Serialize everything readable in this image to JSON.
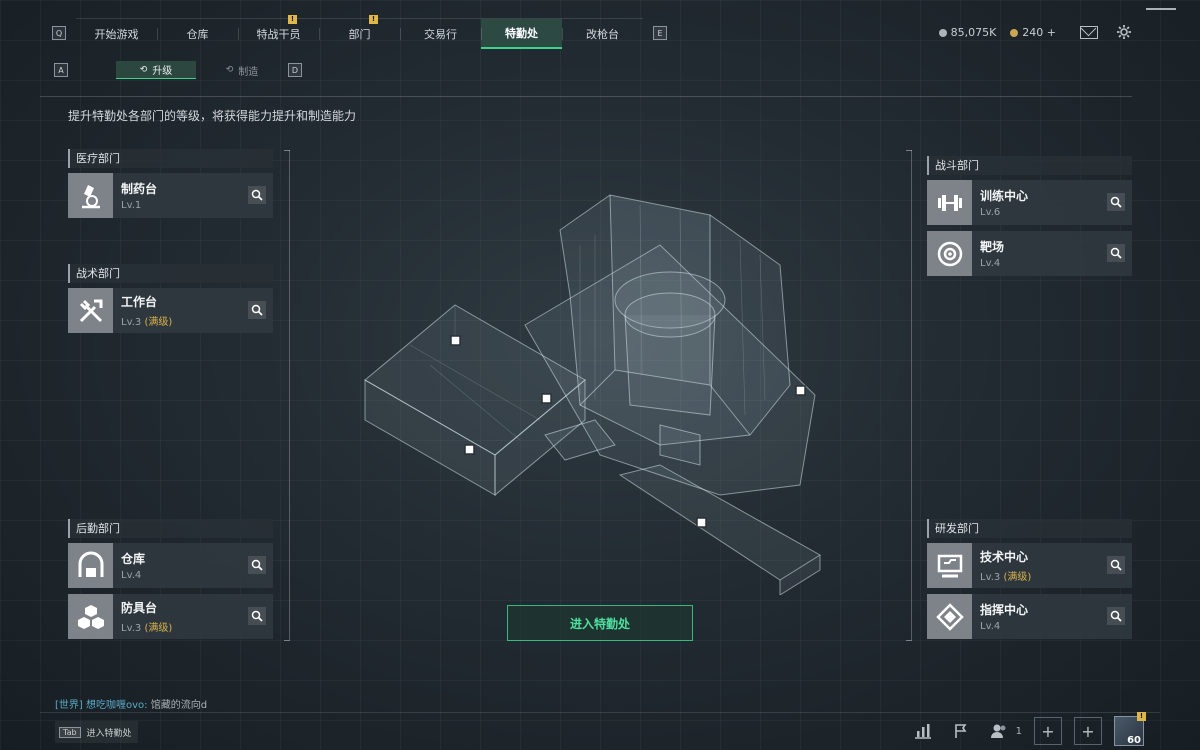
{
  "nav": {
    "key_left": "Q",
    "key_right": "E",
    "tabs": [
      {
        "label": "开始游戏",
        "alert": false,
        "active": false
      },
      {
        "label": "仓库",
        "alert": false,
        "active": false
      },
      {
        "label": "特战干员",
        "alert": true,
        "active": false
      },
      {
        "label": "部门",
        "alert": true,
        "active": false
      },
      {
        "label": "交易行",
        "alert": false,
        "active": false
      },
      {
        "label": "特勤处",
        "alert": false,
        "active": true
      },
      {
        "label": "改枪台",
        "alert": false,
        "active": false
      }
    ],
    "alert_mark": "!"
  },
  "currency": {
    "silver": "85,075K",
    "gold": "240 +"
  },
  "subnav": {
    "key_left": "A",
    "key_right": "D",
    "tabs": [
      {
        "label": "升级",
        "active": true
      },
      {
        "label": "制造",
        "active": false
      }
    ]
  },
  "description": "提升特勤处各部门的等级，将获得能力提升和制造能力",
  "departments": {
    "medical": {
      "title": "医疗部门",
      "facilities": [
        {
          "name": "制药台",
          "level": "Lv.1",
          "max": ""
        }
      ]
    },
    "tactical": {
      "title": "战术部门",
      "facilities": [
        {
          "name": "工作台",
          "level": "Lv.3",
          "max": "(满级)"
        }
      ]
    },
    "logistics": {
      "title": "后勤部门",
      "facilities": [
        {
          "name": "仓库",
          "level": "Lv.4",
          "max": ""
        },
        {
          "name": "防具台",
          "level": "Lv.3",
          "max": "(满级)"
        }
      ]
    },
    "combat": {
      "title": "战斗部门",
      "facilities": [
        {
          "name": "训练中心",
          "level": "Lv.6",
          "max": ""
        },
        {
          "name": "靶场",
          "level": "Lv.4",
          "max": ""
        }
      ]
    },
    "research": {
      "title": "研发部门",
      "facilities": [
        {
          "name": "技术中心",
          "level": "Lv.3",
          "max": "(满级)"
        },
        {
          "name": "指挥中心",
          "level": "Lv.4",
          "max": ""
        }
      ]
    }
  },
  "enter_button": "进入特勤处",
  "chat": {
    "channel": "[世界]",
    "sender": "想吃咖喱ovo:",
    "message": "馆藏的流向d"
  },
  "tab_hint": {
    "key": "Tab",
    "label": "进入特勤处"
  },
  "bottom": {
    "friend_count": "1",
    "player_level": "60",
    "alert_mark": "!"
  }
}
